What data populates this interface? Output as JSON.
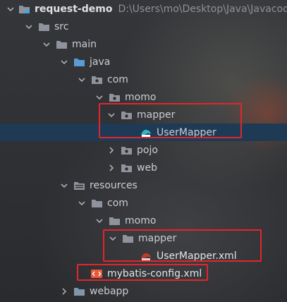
{
  "tree": {
    "project": {
      "label": "request-demo",
      "path": "D:\\Users\\mo\\Desktop\\Java\\Javacod"
    },
    "src": "src",
    "main": "main",
    "java": "java",
    "com1": "com",
    "momo1": "momo",
    "mapper1": "mapper",
    "usermapper": "UserMapper",
    "pojo": "pojo",
    "web": "web",
    "resources": "resources",
    "com2": "com",
    "momo2": "momo",
    "mapper2": "mapper",
    "usermapper_xml": "UserMapper.xml",
    "mybatis_config": "mybatis-config.xml",
    "webapp": "webapp"
  },
  "colors": {
    "folder": "#8f949c",
    "source_folder": "#5b9bd5",
    "highlight_box": "#e0262d",
    "selection": "#1f3a55",
    "xml_icon": "#e85a3c"
  }
}
